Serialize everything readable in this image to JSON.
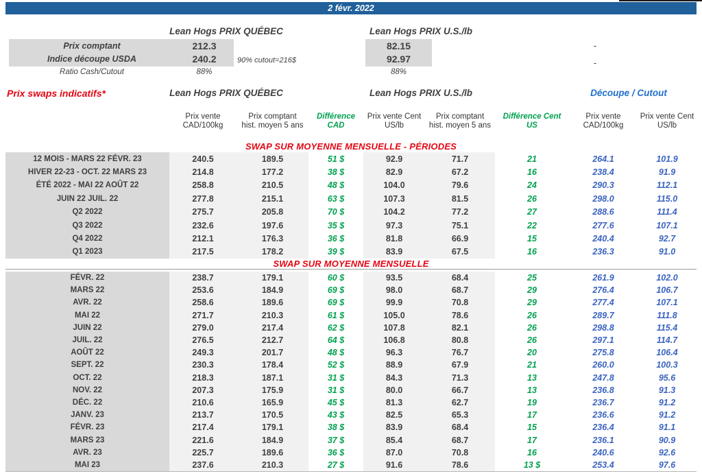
{
  "colors": {
    "bar_blue": "#20609B",
    "section_red": "#E30613",
    "diff_green": "#00A14F",
    "cutout_blue_text": "#3A63C0",
    "cutout_header_blue": "#2070CC",
    "label_gray": "#D9D9D9",
    "band_gray": "#F1F1F2"
  },
  "date_bar": {
    "label": "2 févr. 2022"
  },
  "top": {
    "quebec_header": "Lean Hogs PRIX QUÉBEC",
    "us_header": "Lean Hogs PRIX U.S./lb",
    "row1": {
      "label": "Prix comptant",
      "qc": "212.3",
      "us": "82.15",
      "dash": "-"
    },
    "row2": {
      "label": "Indice découpe USDA",
      "qc": "240.2",
      "note": "90% cutout=216$",
      "us": "92.97",
      "dash": "-"
    },
    "row3": {
      "label": "Ratio Cash/Cutout",
      "qc": "88%",
      "us": "88%"
    }
  },
  "swaps": {
    "title": "Prix swaps indicatifs*",
    "group_headers": {
      "quebec": "Lean Hogs PRIX QUÉBEC",
      "us": "Lean Hogs PRIX U.S./lb",
      "cutout": "Découpe / Cutout"
    },
    "col_headers": [
      "Prix vente CAD/100kg",
      "Prix comptant hist. moyen 5 ans",
      "Différence CAD",
      "Prix vente Cent US/lb",
      "Prix comptant hist. moyen 5 ans",
      "Différence Cent US",
      "Prix vente CAD/100kg",
      "Prix vente Cent US/lb"
    ],
    "sections": [
      {
        "header": "SWAP SUR MOYENNE MENSUELLE - PÉRIODES",
        "rows": [
          [
            "12 MOIS - MARS 22 FÉVR. 23",
            "240.5",
            "189.5",
            "51 $",
            "92.9",
            "71.7",
            "21",
            "264.1",
            "101.9"
          ],
          [
            "HIVER 22-23 - OCT. 22 MARS 23",
            "214.8",
            "177.2",
            "38 $",
            "82.9",
            "67.2",
            "16",
            "238.4",
            "91.9"
          ],
          [
            "ÉTÉ 2022 - MAI 22 AOÛT 22",
            "258.8",
            "210.5",
            "48 $",
            "104.0",
            "79.6",
            "24",
            "290.3",
            "112.1"
          ],
          [
            "JUIN 22 JUIL. 22",
            "277.8",
            "215.1",
            "63 $",
            "107.3",
            "81.5",
            "26",
            "298.0",
            "115.0"
          ],
          [
            "Q2 2022",
            "275.7",
            "205.8",
            "70 $",
            "104.2",
            "77.2",
            "27",
            "288.6",
            "111.4"
          ],
          [
            "Q3 2022",
            "232.6",
            "197.6",
            "35 $",
            "97.3",
            "75.1",
            "22",
            "277.6",
            "107.1"
          ],
          [
            "Q4 2022",
            "212.1",
            "176.3",
            "36 $",
            "81.8",
            "66.9",
            "15",
            "240.4",
            "92.7"
          ],
          [
            "Q1 2023",
            "217.5",
            "178.2",
            "39 $",
            "83.9",
            "67.5",
            "16",
            "236.3",
            "91.0"
          ]
        ]
      },
      {
        "header": "SWAP SUR MOYENNE MENSUELLE",
        "rows": [
          [
            "FÉVR. 22",
            "238.7",
            "179.1",
            "60 $",
            "93.5",
            "68.4",
            "25",
            "261.9",
            "102.0"
          ],
          [
            "MARS 22",
            "253.6",
            "184.9",
            "69 $",
            "98.0",
            "68.7",
            "29",
            "276.4",
            "106.7"
          ],
          [
            "AVR. 22",
            "258.6",
            "189.6",
            "69 $",
            "99.9",
            "70.8",
            "29",
            "277.4",
            "107.1"
          ],
          [
            "MAI 22",
            "271.7",
            "210.3",
            "61 $",
            "105.0",
            "78.6",
            "26",
            "289.7",
            "111.8"
          ],
          [
            "JUIN 22",
            "279.0",
            "217.4",
            "62 $",
            "107.8",
            "82.1",
            "26",
            "298.8",
            "115.4"
          ],
          [
            "JUIL. 22",
            "276.5",
            "212.7",
            "64 $",
            "106.8",
            "80.8",
            "26",
            "297.1",
            "114.7"
          ],
          [
            "AOÛT 22",
            "249.3",
            "201.7",
            "48 $",
            "96.3",
            "76.7",
            "20",
            "275.8",
            "106.4"
          ],
          [
            "SEPT. 22",
            "230.3",
            "178.4",
            "52 $",
            "88.9",
            "67.9",
            "21",
            "260.0",
            "100.3"
          ],
          [
            "OCT. 22",
            "218.3",
            "187.1",
            "31 $",
            "84.3",
            "71.3",
            "13",
            "247.8",
            "95.6"
          ],
          [
            "NOV. 22",
            "207.3",
            "175.9",
            "31 $",
            "80.0",
            "66.7",
            "13",
            "236.8",
            "91.3"
          ],
          [
            "DÉC. 22",
            "210.6",
            "165.9",
            "45 $",
            "81.3",
            "62.7",
            "19",
            "236.7",
            "91.2"
          ],
          [
            "JANV. 23",
            "213.7",
            "170.5",
            "43 $",
            "82.5",
            "65.3",
            "17",
            "236.6",
            "91.2"
          ],
          [
            "FÉVR. 23",
            "217.4",
            "179.1",
            "38 $",
            "83.9",
            "68.4",
            "15",
            "236.4",
            "91.1"
          ],
          [
            "MARS 23",
            "221.6",
            "184.9",
            "37 $",
            "85.4",
            "68.7",
            "17",
            "236.1",
            "90.9"
          ],
          [
            "AVR. 23",
            "225.7",
            "189.6",
            "36 $",
            "87.0",
            "70.8",
            "16",
            "240.6",
            "92.6"
          ],
          [
            "MAI 23",
            "237.6",
            "210.3",
            "27 $",
            "91.6",
            "78.6",
            "13 $",
            "253.4",
            "97.6"
          ]
        ]
      }
    ]
  }
}
